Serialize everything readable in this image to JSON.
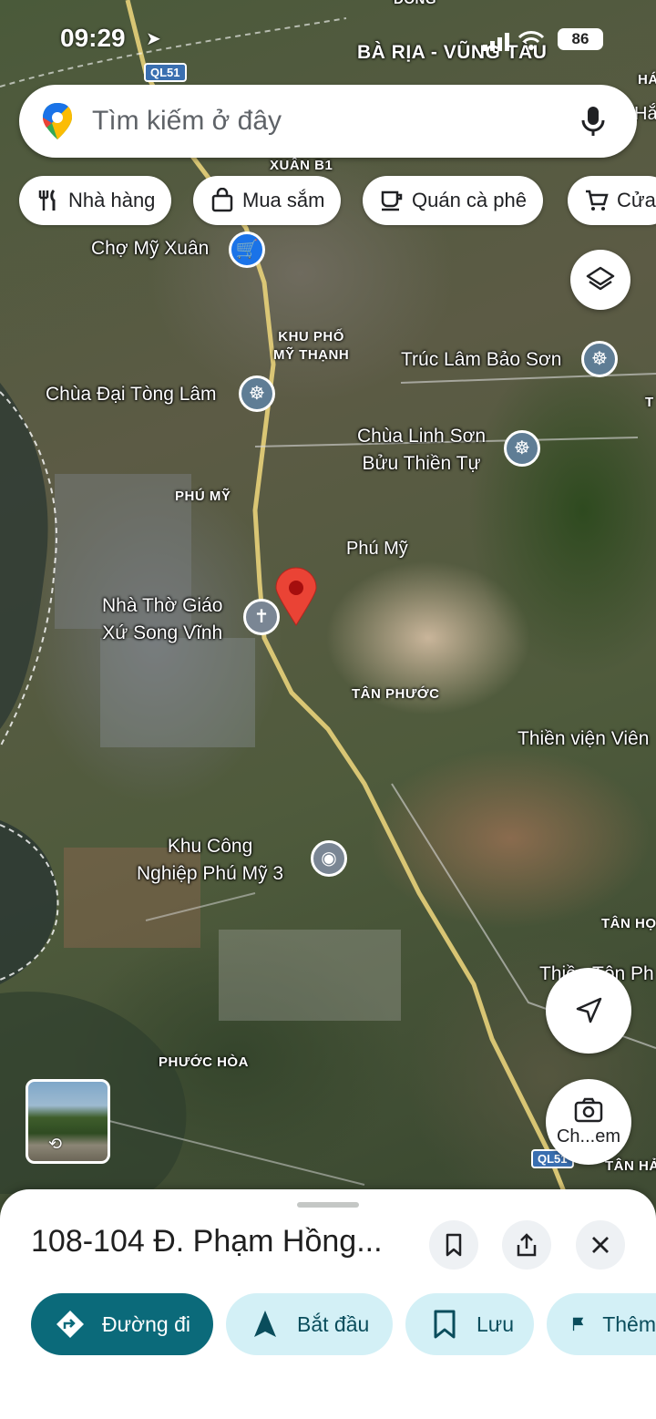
{
  "status_bar": {
    "time": "09:29",
    "battery": "86"
  },
  "search": {
    "placeholder": "Tìm kiếm ở đây"
  },
  "chips": [
    {
      "label": "Nhà hàng",
      "icon": "fork-knife-icon"
    },
    {
      "label": "Mua sắm",
      "icon": "shopping-bag-icon"
    },
    {
      "label": "Quán cà phê",
      "icon": "coffee-cup-icon"
    },
    {
      "label": "Cửa",
      "icon": "cart-icon"
    }
  ],
  "map": {
    "road_shields": [
      "QL51",
      "QL51"
    ],
    "regions": {
      "province": "BÀ RỊA - VŨNG TÀU",
      "xuan": "XUÂN B1",
      "khu_pho": "KHU PHỐ\nMỸ THẠNH",
      "phu_my_small": "PHÚ MỸ",
      "phu_my": "Phú Mỹ",
      "tan_phuoc": "TÂN PHƯỚC",
      "phuoc_hoa": "PHƯỚC HÒA",
      "tan_ho": "TÂN HỌ",
      "tan_ha": "TÂN HẢ",
      "top_edge": "ĐỒNG",
      "ha_edge": "HÁ",
      "ha_edge2": "Hắ",
      "t_edge": "T"
    },
    "places": {
      "cho_my_xuan": "Chợ Mỹ Xuân",
      "truc_lam": "Trúc Lâm Bảo Sơn",
      "chua_dai_tong_lam": "Chùa Đại Tòng Lâm",
      "chua_linh_son": "Chùa Linh Sơn\nBửu Thiền Tự",
      "nha_tho": "Nhà Thờ Giáo\nXứ Song Vĩnh",
      "thien_vien": "Thiền viện Viên",
      "kcn": "Khu Công\nNghiệp Phú Mỹ 3",
      "thien_ton": "Thiền Tôn Ph"
    }
  },
  "camera_button": {
    "label": "Ch...em"
  },
  "sheet": {
    "title": "108-104 Đ. Phạm Hồng...",
    "actions": [
      {
        "label": "Đường đi",
        "icon": "directions-icon"
      },
      {
        "label": "Bắt đầu",
        "icon": "navigation-arrow-icon"
      },
      {
        "label": "Lưu",
        "icon": "bookmark-icon"
      },
      {
        "label": "Thêm",
        "icon": "flag-icon"
      }
    ]
  },
  "colors": {
    "accent": "#0b6a7a",
    "secondary_bg": "#d3f0f6",
    "pin": "#ea4335"
  }
}
